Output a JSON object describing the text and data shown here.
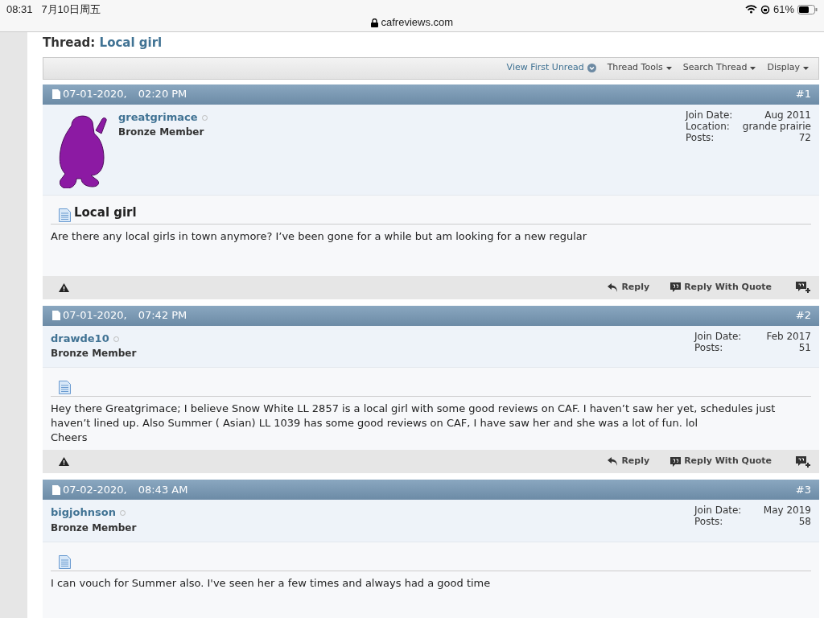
{
  "status_bar": {
    "time": "08:31",
    "date": "7月10日周五",
    "battery": "61%"
  },
  "address_bar": {
    "url": "cafreviews.com"
  },
  "thread": {
    "label": "Thread:",
    "title": "Local girl"
  },
  "toolbar": [
    {
      "label": "View First Unread",
      "kind": "link"
    },
    {
      "label": "Thread Tools",
      "kind": "menu"
    },
    {
      "label": "Search Thread",
      "kind": "menu"
    },
    {
      "label": "Display",
      "kind": "menu"
    }
  ],
  "posts": [
    {
      "date": "07-01-2020,",
      "time": "02:20 PM",
      "number": "#1",
      "username": "greatgrimace",
      "online": false,
      "rank": "Bronze Member",
      "has_avatar": true,
      "stats": [
        {
          "label": "Join Date:",
          "value": "Aug 2011"
        },
        {
          "label": "Location:",
          "value": "grande prairie"
        },
        {
          "label": "Posts:",
          "value": "72"
        }
      ],
      "title": "Local girl",
      "body": [
        "Are there any local girls in town anymore? I’ve been gone for a while but am looking for a new regular"
      ],
      "footer": [
        "Reply",
        "Reply With Quote"
      ]
    },
    {
      "date": "07-01-2020,",
      "time": "07:42 PM",
      "number": "#2",
      "username": "drawde10",
      "online": false,
      "rank": "Bronze Member",
      "has_avatar": false,
      "stats": [
        {
          "label": "Join Date:",
          "value": "Feb 2017"
        },
        {
          "label": "Posts:",
          "value": "51"
        }
      ],
      "body": [
        "Hey there Greatgrimace; I believe Snow White LL 2857 is a local girl with some good reviews on CAF. I haven’t saw her yet, schedules just haven’t lined up. Also Summer ( Asian) LL 1039 has some good reviews on CAF, I have saw her and she was a lot of fun. lol",
        "Cheers"
      ],
      "footer": [
        "Reply",
        "Reply With Quote"
      ]
    },
    {
      "date": "07-02-2020,",
      "time": "08:43 AM",
      "number": "#3",
      "username": "bigjohnson",
      "online": false,
      "rank": "Bronze Member",
      "has_avatar": false,
      "stats": [
        {
          "label": "Join Date:",
          "value": "May 2019"
        },
        {
          "label": "Posts:",
          "value": "58"
        }
      ],
      "body": [
        "I can vouch for Summer also. I've seen her a few times and always had a good time"
      ]
    }
  ]
}
